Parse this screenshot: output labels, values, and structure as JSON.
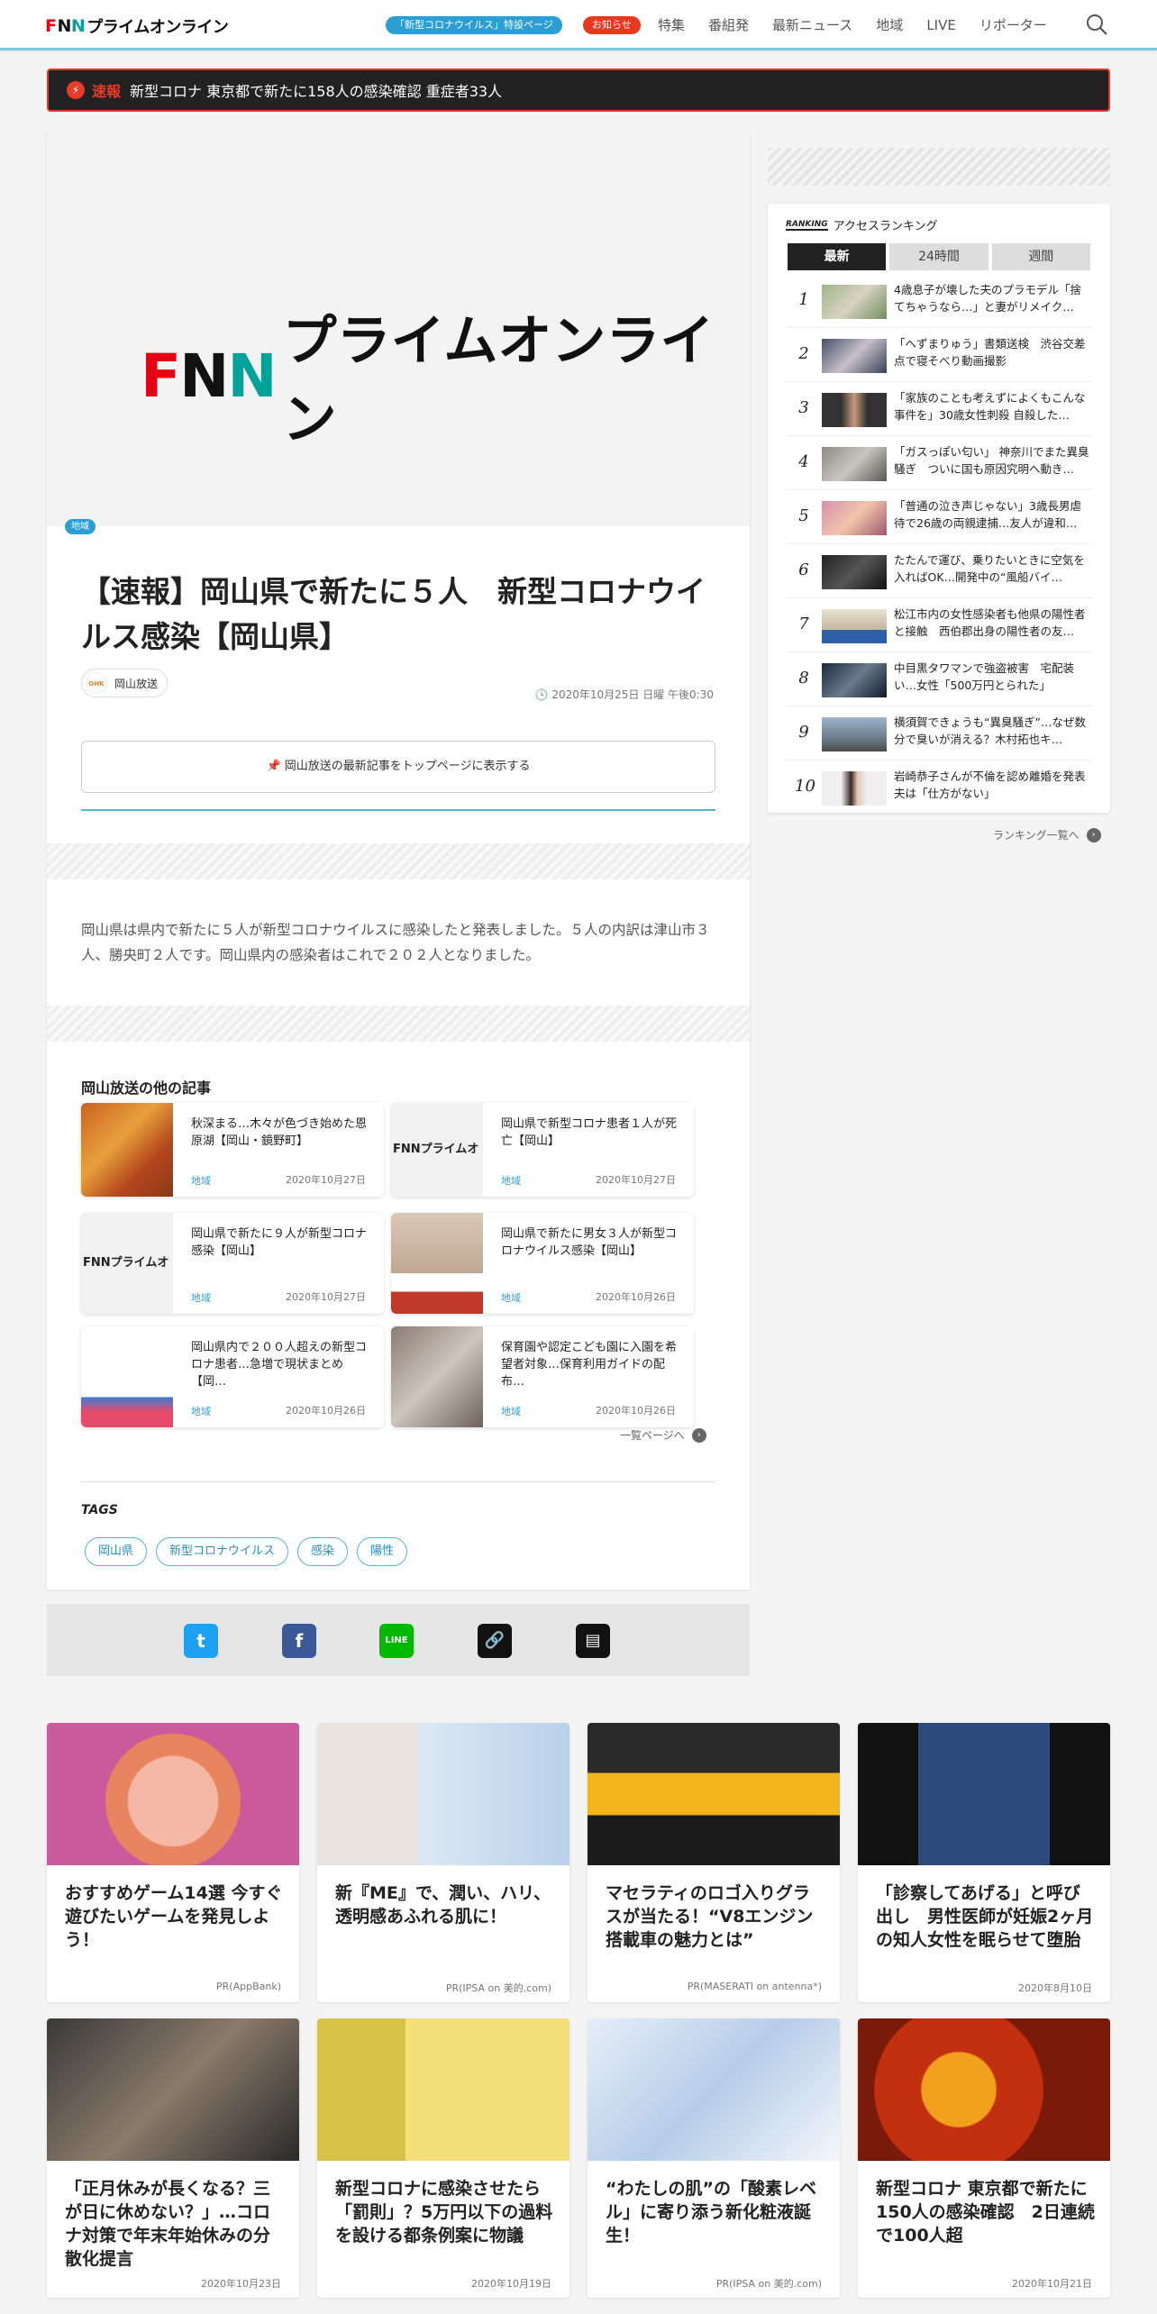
{
  "header": {
    "logo_text": "FNNプライムオンライン",
    "covid_pill": "「新型コロナウイルス」特設ページ",
    "news_pill": "お知らせ",
    "nav": [
      "特集",
      "番組発",
      "最新ニュース",
      "地域",
      "LIVE",
      "リポーター"
    ]
  },
  "breaking": {
    "label": "速報",
    "text": "新型コロナ 東京都で新たに158人の感染確認 重症者33人"
  },
  "article": {
    "hero_logo": "FNNプライムオンライン",
    "category": "地域",
    "title": "【速報】岡山県で新たに５人　新型コロナウイルス感染【岡山県】",
    "publisher": "岡山放送",
    "publisher_logo": "OHK",
    "date": "2020年10月25日 日曜 午後0:30",
    "pin_button": "岡山放送の最新記事をトップページに表示する",
    "body": "岡山県は県内で新たに５人が新型コロナウイルスに感染したと発表しました。５人の内訳は津山市３人、勝央町２人です。岡山県内の感染者はこれで２０２人となりました。",
    "other_title": "岡山放送の他の記事",
    "other_articles": [
      {
        "title": "秋深まる…木々が色づき始めた恩原湖【岡山・鏡野町】",
        "tag": "地域",
        "date": "2020年10月27日"
      },
      {
        "title": "岡山県で新型コロナ患者１人が死亡【岡山】",
        "tag": "地域",
        "date": "2020年10月27日"
      },
      {
        "title": "岡山県で新たに９人が新型コロナ感染【岡山】",
        "tag": "地域",
        "date": "2020年10月27日"
      },
      {
        "title": "岡山県で新たに男女３人が新型コロナウイルス感染【岡山】",
        "tag": "地域",
        "date": "2020年10月26日"
      },
      {
        "title": "岡山県内で２００人超えの新型コロナ患者…急増で現状まとめ【岡…",
        "tag": "地域",
        "date": "2020年10月26日"
      },
      {
        "title": "保育園や認定こども園に入園を希望者対象…保育利用ガイドの配布…",
        "tag": "地域",
        "date": "2020年10月26日"
      }
    ],
    "more_label": "一覧ページへ",
    "tags_label": "TAGS",
    "tags": [
      "岡山県",
      "新型コロナウイルス",
      "感染",
      "陽性"
    ]
  },
  "share": {
    "icons": [
      "twitter-icon",
      "facebook-icon",
      "line-icon",
      "link-icon",
      "comment-icon"
    ]
  },
  "ranking": {
    "badge": "RANKING",
    "title": "アクセスランキング",
    "tabs": [
      "最新",
      "24時間",
      "週間"
    ],
    "items": [
      {
        "rank": "1",
        "text": "4歳息子が壊した夫のプラモデル「捨てちゃうなら…」と妻がリメイク…"
      },
      {
        "rank": "2",
        "text": "「へずまりゅう」書類送検　渋谷交差点で寝そべり動画撮影"
      },
      {
        "rank": "3",
        "text": "「家族のことも考えずによくもこんな事件を」30歳女性刺殺 自殺した…"
      },
      {
        "rank": "4",
        "text": "「ガスっぽい匂い」 神奈川でまた異臭騒ぎ　ついに国も原因究明へ動き…"
      },
      {
        "rank": "5",
        "text": "「普通の泣き声じゃない」3歳長男虐待で26歳の両親逮捕…友人が違和…"
      },
      {
        "rank": "6",
        "text": "たたんで運び、乗りたいときに空気を入ればOK…開発中の“風船バイ…"
      },
      {
        "rank": "7",
        "text": "松江市内の女性感染者も他県の陽性者と接触　西伯郡出身の陽性者の友…"
      },
      {
        "rank": "8",
        "text": "中目黒タワマンで強盗被害　宅配装い…女性「500万円とられた」"
      },
      {
        "rank": "9",
        "text": "横須賀できょうも“異臭騒ぎ”…なぜ数分で臭いが消える？木村拓也キ…"
      },
      {
        "rank": "10",
        "text": "岩崎恭子さんが不倫を認め離婚を発表　夫は「仕方がない」"
      }
    ],
    "more_label": "ランキング一覧へ"
  },
  "recommend": [
    {
      "title": "おすすめゲーム14選 今すぐ遊びたいゲームを発見しよう！",
      "source": "PR(AppBank)"
    },
    {
      "title": "新『ME』で、潤い、ハリ、透明感あふれる肌に！",
      "source": "PR(IPSA on 美的.com)"
    },
    {
      "title": "マセラティのロゴ入りグラスが当たる！“V8エンジン搭載車の魅力とは”",
      "source": "PR(MASERATI on antenna*)"
    },
    {
      "title": "「診察してあげる」と呼び出し　男性医師が妊娠2ヶ月の知人女性を眠らせて堕胎",
      "source": "2020年8月10日"
    },
    {
      "title": "「正月休みが長くなる？三が日に休めない？」…コロナ対策で年末年始休みの分散化提言",
      "source": "2020年10月23日"
    },
    {
      "title": "新型コロナに感染させたら「罰則」？5万円以下の過料を設ける都条例案に物議",
      "source": "2020年10月19日"
    },
    {
      "title": "“わたしの肌”の「酸素レベル」に寄り添う新化粧液誕生！",
      "source": "PR(IPSA on 美的.com)"
    },
    {
      "title": "新型コロナ 東京都で新たに150人の感染確認　2日連続で100人超",
      "source": "2020年10月21日"
    }
  ],
  "colors": {
    "accent": "#2b9ed6",
    "alert": "#e63a2a",
    "brand_red": "#e60012",
    "brand_green": "#00a29a"
  }
}
